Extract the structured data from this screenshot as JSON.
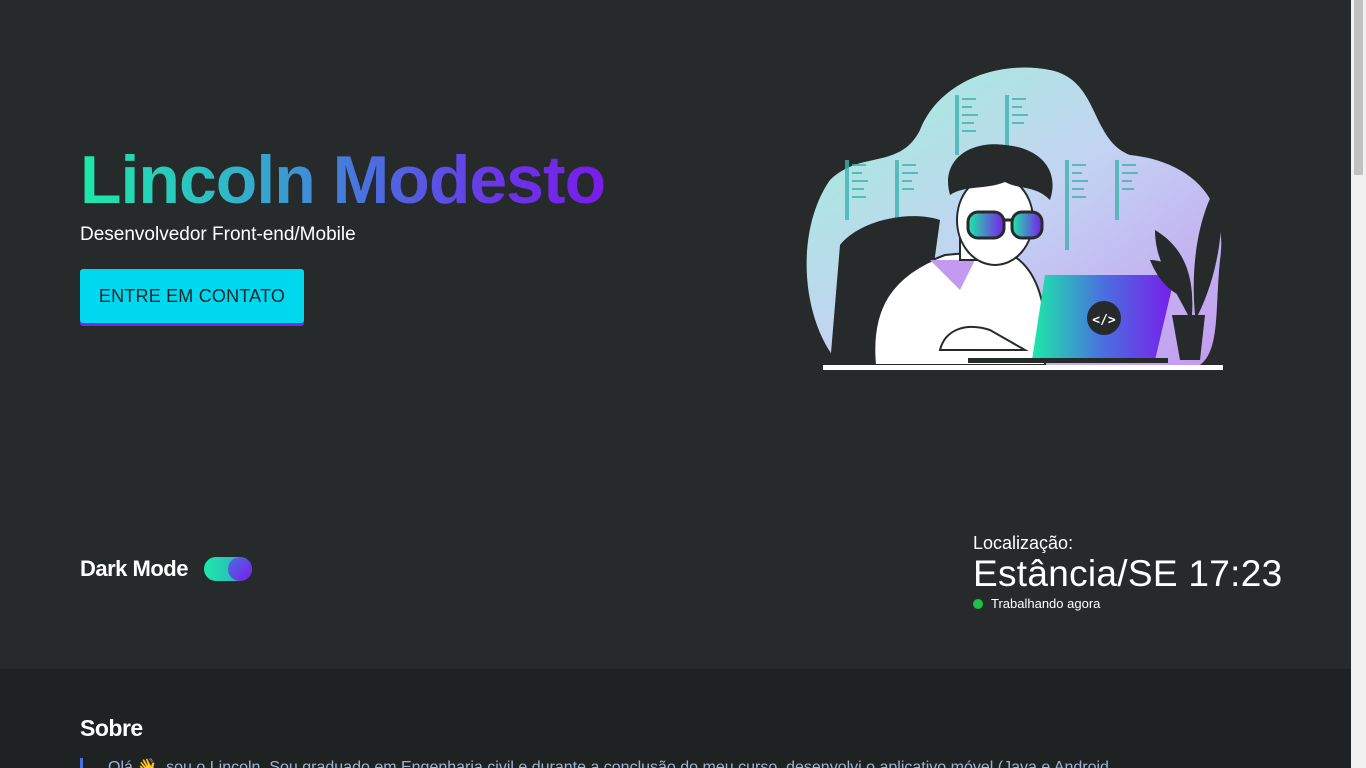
{
  "hero": {
    "name": "Lincoln Modesto",
    "subtitle": "Desenvolvedor Front-end/Mobile",
    "cta_label": "ENTRE EM CONTATO",
    "code_icon_label": "</>"
  },
  "dark_mode": {
    "label": "Dark Mode",
    "enabled": true
  },
  "location": {
    "label": "Localização:",
    "value": "Estância/SE 17:23",
    "status": "Trabalhando agora",
    "status_color": "#1fbf4a"
  },
  "about": {
    "title": "Sobre",
    "text": "Olá 👋, sou o Lincoln. Sou graduado em Engenharia civil e durante a conclusão do meu curso, desenvolvi o aplicativo móvel (Java e Android"
  },
  "colors": {
    "background": "#262a2b",
    "section_background": "#1e2223",
    "accent_cyan": "#00d8f0",
    "gradient_start": "#1de9a8",
    "gradient_end": "#7a1cea"
  }
}
